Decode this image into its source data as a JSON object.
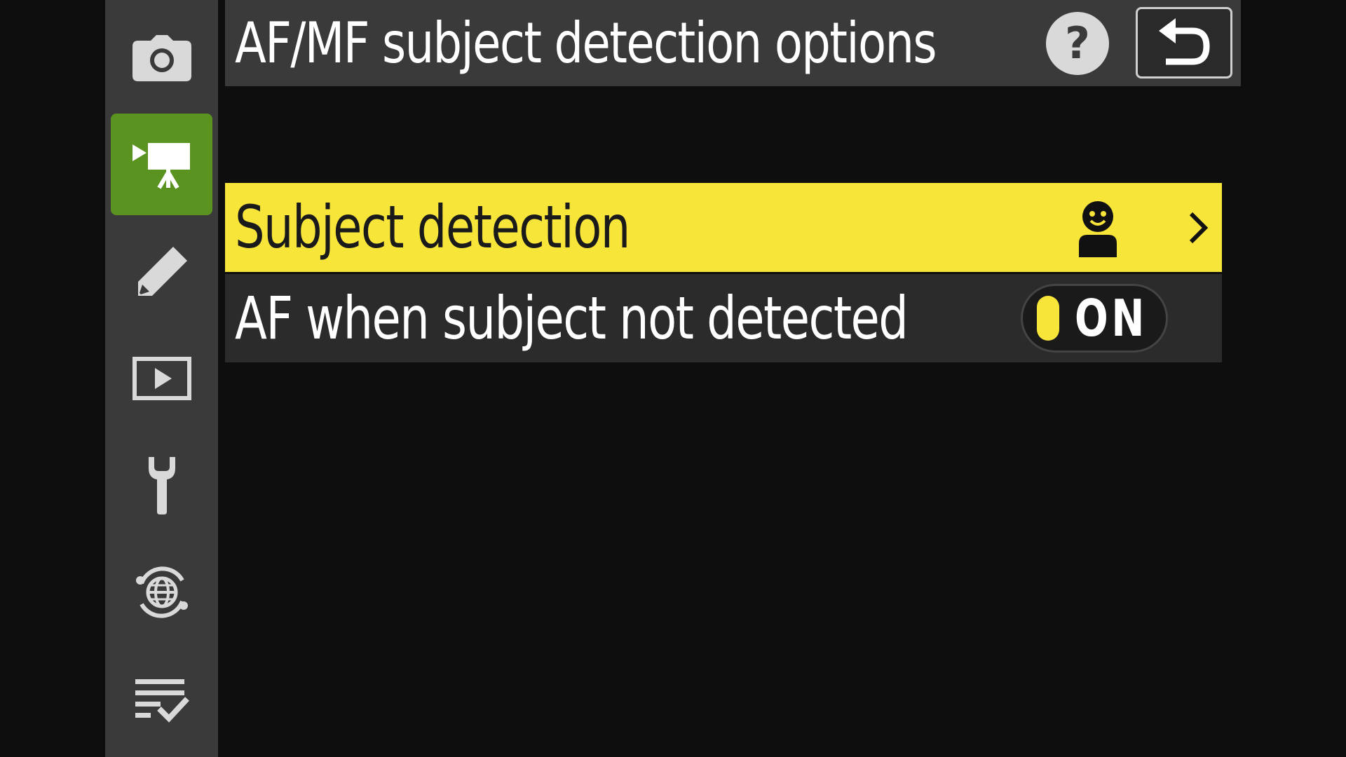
{
  "header": {
    "title": "AF/MF subject detection options",
    "help_icon": "question-mark-icon",
    "help_glyph": "?",
    "back_icon": "return-arrow-icon"
  },
  "sidebar": {
    "items": [
      {
        "name": "photo-shooting-menu",
        "icon": "camera-icon",
        "active": false
      },
      {
        "name": "video-recording-menu",
        "icon": "movie-camera-icon",
        "active": true
      },
      {
        "name": "custom-settings-menu",
        "icon": "pencil-icon",
        "active": false
      },
      {
        "name": "playback-menu",
        "icon": "play-icon",
        "active": false
      },
      {
        "name": "setup-menu",
        "icon": "wrench-icon",
        "active": false
      },
      {
        "name": "network-menu",
        "icon": "globe-icon",
        "active": false
      },
      {
        "name": "my-menu",
        "icon": "checklist-icon",
        "active": false
      }
    ]
  },
  "menu": {
    "items": [
      {
        "label": "Subject detection",
        "value_icon": "person-face-icon",
        "has_submenu": true,
        "selected": true
      },
      {
        "label": "AF when subject not detected",
        "toggle_value": "ON",
        "selected": false
      }
    ]
  },
  "colors": {
    "background": "#0e0e0e",
    "panel": "#3a3a3a",
    "highlight": "#f8e53a",
    "active_tab": "#5b9321",
    "row": "#2b2b2b"
  }
}
